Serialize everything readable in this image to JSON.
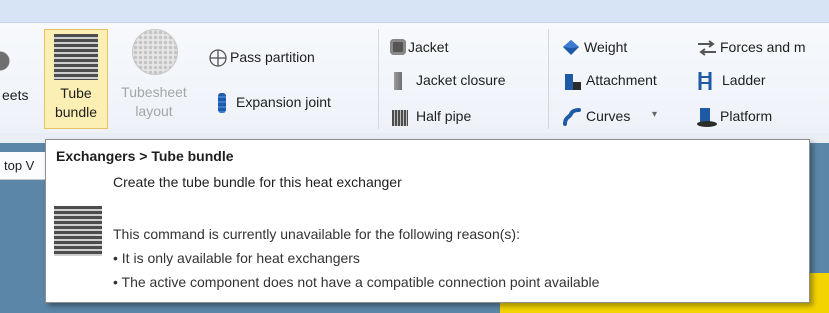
{
  "ribbon": {
    "sheets_fragment": "eets",
    "tube_bundle": {
      "line1": "Tube",
      "line2": "bundle"
    },
    "tubesheet_layout": {
      "line1": "Tubesheet",
      "line2": "layout"
    },
    "pass_partition": "Pass partition",
    "expansion_joint": "Expansion joint",
    "jacket": "Jacket",
    "jacket_closure": "Jacket closure",
    "half_pipe": "Half pipe",
    "weight": "Weight",
    "attachment": "Attachment",
    "curves": "Curves",
    "forces": "Forces and m",
    "ladder": "Ladder",
    "platform": "Platform"
  },
  "workspace": {
    "tab_fragment": "top V"
  },
  "tooltip": {
    "title": "Exchangers > Tube bundle",
    "description": "Create the tube bundle for this heat exchanger",
    "unavailable": "This command is currently unavailable for the following reason(s):",
    "reasons": [
      "• It is only available for heat exchangers",
      "• The active component does not have a compatible connection point available"
    ]
  },
  "colors": {
    "ribbon_bg": "#f3f6fa",
    "selected_bg": "#fcefb4",
    "selected_border": "#e5c365",
    "workspace_bg": "#5b86a7",
    "accent_yellow": "#f4d400",
    "icon_blue": "#1f5aa6"
  },
  "icons": {
    "tube_bundle": "tube-bundle-icon",
    "tubesheet": "tubesheet-layout-icon",
    "pass_partition": "pass-partition-icon",
    "expansion_joint": "expansion-joint-icon",
    "jacket": "jacket-icon",
    "jacket_closure": "jacket-closure-icon",
    "half_pipe": "half-pipe-icon",
    "weight": "weight-icon",
    "attachment": "attachment-icon",
    "curves": "curves-icon",
    "forces": "forces-icon",
    "ladder": "ladder-icon",
    "platform": "platform-icon"
  }
}
